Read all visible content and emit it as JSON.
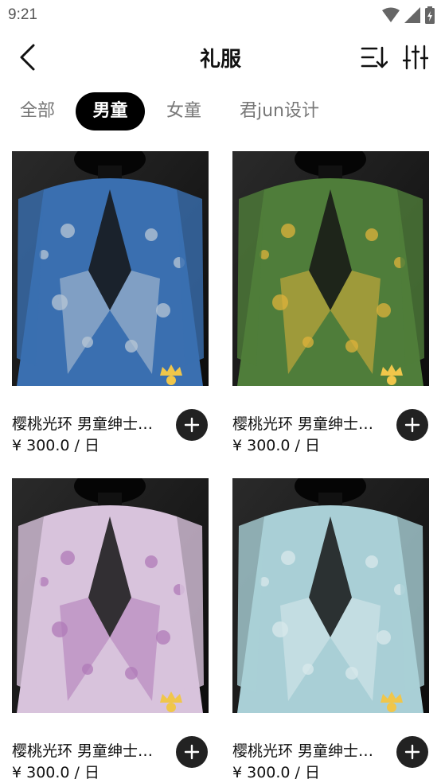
{
  "status_bar": {
    "time": "9:21"
  },
  "nav": {
    "title": "礼服",
    "icons": [
      "back-icon",
      "sort-icon",
      "filter-sliders-icon"
    ]
  },
  "tabs": [
    {
      "label": "全部",
      "active": false
    },
    {
      "label": "男童",
      "active": true
    },
    {
      "label": "女童",
      "active": false
    },
    {
      "label": "君jun设计",
      "active": false
    }
  ],
  "products": [
    {
      "title": "樱桃光环 男童绅士礼服",
      "price": "¥ 300.0 / 日",
      "jacket_color": "#3a6fb0",
      "accent_color": "#b9c7d6"
    },
    {
      "title": "樱桃光环 男童绅士礼服",
      "price": "¥ 300.0 / 日",
      "jacket_color": "#4f7d3a",
      "accent_color": "#e0b33a"
    },
    {
      "title": "樱桃光环 男童绅士礼服",
      "price": "¥ 300.0 / 日",
      "jacket_color": "#d8c3dc",
      "accent_color": "#b07ab8"
    },
    {
      "title": "樱桃光环 男童绅士礼服",
      "price": "¥ 300.0 / 日",
      "jacket_color": "#a9cfd6",
      "accent_color": "#d9e9ec"
    }
  ]
}
